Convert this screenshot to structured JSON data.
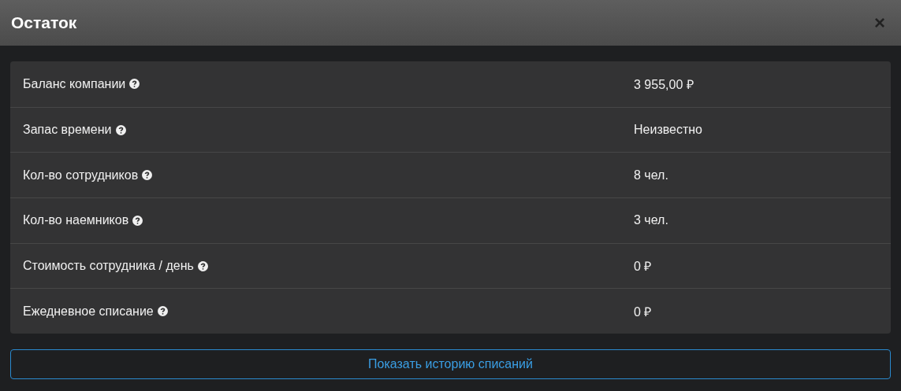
{
  "window": {
    "title": "Остаток",
    "close": "×"
  },
  "rows": [
    {
      "label": "Баланс компании",
      "value": "3 955,00 ₽"
    },
    {
      "label": "Запас времени",
      "value": "Неизвестно"
    },
    {
      "label": "Кол-во сотрудников",
      "value": "8 чел."
    },
    {
      "label": "Кол-во наемников",
      "value": "3 чел."
    },
    {
      "label": "Стоимость сотрудника / день",
      "value": "0 ₽"
    },
    {
      "label": "Ежедневное списание",
      "value": "0 ₽"
    }
  ],
  "button": "Показать историю списаний"
}
